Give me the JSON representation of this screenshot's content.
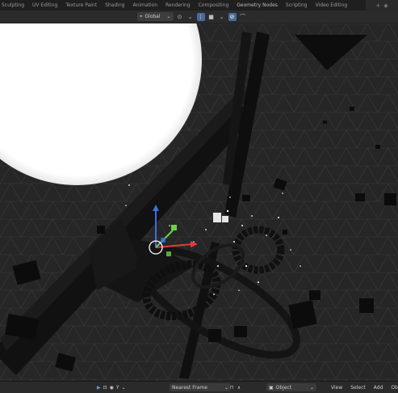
{
  "workspace_tabs": [
    "Sculpting",
    "UV Editing",
    "Texture Paint",
    "Shading",
    "Animation",
    "Rendering",
    "Compositing",
    "Geometry Nodes",
    "Scripting",
    "Video Editing"
  ],
  "header": {
    "orientation": "Global",
    "orientation_icon": "transform-orientation-icon"
  },
  "footer": {
    "keying": "Nearest Frame",
    "mode": "Object",
    "menu": [
      "View",
      "Select",
      "Add",
      "Ob"
    ]
  },
  "colors": {
    "sun": "#ffffff",
    "axis_x": "#e23b3b",
    "axis_y": "#6ad04a",
    "axis_z": "#3b6fe2"
  }
}
